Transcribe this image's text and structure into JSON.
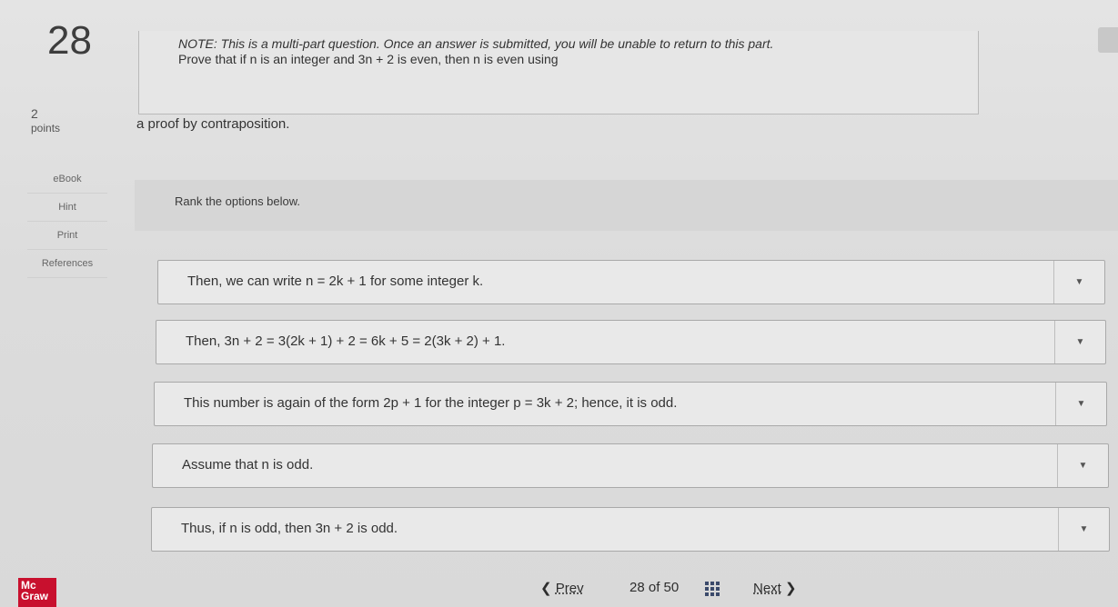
{
  "question": {
    "number": "28",
    "points_value": "2",
    "points_label": "points",
    "note": "NOTE: This is a multi-part question. Once an answer is submitted, you will be unable to return to this part.",
    "prompt": "Prove that if n is an integer and 3n + 2 is even, then n is even using",
    "sub_prompt": "a proof by contraposition."
  },
  "side_links": [
    "eBook",
    "Hint",
    "Print",
    "References"
  ],
  "rank_instruction": "Rank the options below.",
  "options": [
    "Then, we can write n = 2k + 1 for some integer k.",
    "Then, 3n + 2 = 3(2k + 1) + 2 = 6k + 5 = 2(3k + 2) + 1.",
    "This number is again of the form 2p + 1 for the integer p = 3k + 2; hence, it is odd.",
    "Assume that n is odd.",
    "Thus, if n is odd, then 3n + 2 is odd."
  ],
  "footer": {
    "logo": "Mc Graw",
    "prev_label": "Prev",
    "current_page": "28",
    "of_label": "of",
    "total_pages": "50",
    "next_label": "Next"
  },
  "colors": {
    "logo_red": "#c8102e",
    "grid_icon": "#3b4a6b"
  }
}
